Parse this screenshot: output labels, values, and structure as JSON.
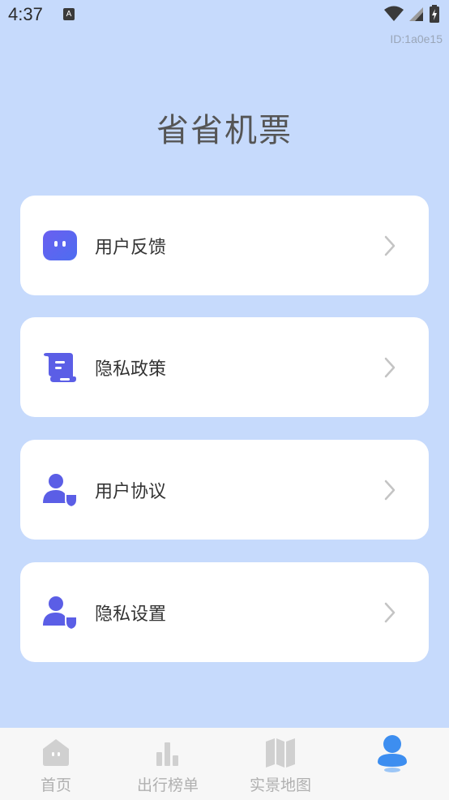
{
  "status_bar": {
    "time": "4:37",
    "notif_badge": "A"
  },
  "id_text": "ID:1a0e15",
  "app_title": "省省机票",
  "menu": [
    {
      "label": "用户反馈",
      "icon": "chat-bot-icon"
    },
    {
      "label": "隐私政策",
      "icon": "scroll-document-icon"
    },
    {
      "label": "用户协议",
      "icon": "user-shield-icon"
    },
    {
      "label": "隐私设置",
      "icon": "user-shield-icon"
    }
  ],
  "tabs": [
    {
      "label": "首页",
      "icon": "home-icon",
      "active": false
    },
    {
      "label": "出行榜单",
      "icon": "bar-chart-icon",
      "active": false
    },
    {
      "label": "实景地图",
      "icon": "map-icon",
      "active": false
    },
    {
      "label": "",
      "icon": "profile-icon",
      "active": true
    }
  ],
  "colors": {
    "background": "#c6dafc",
    "accent": "#5b5ee6",
    "active_tab": "#3d8ef0",
    "inactive_tab": "#b0b0b0"
  }
}
